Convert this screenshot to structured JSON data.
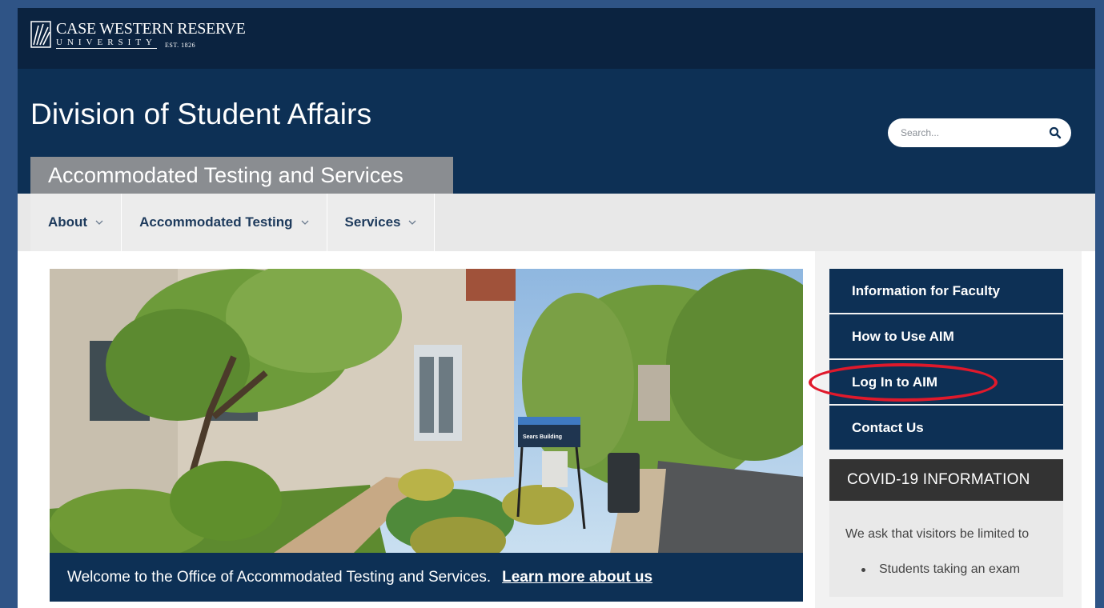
{
  "logo": {
    "name": "CASE WESTERN RESERVE",
    "university": "UNIVERSITY",
    "established": "EST. 1826"
  },
  "header": {
    "division_title": "Division of Student Affairs",
    "department": "Accommodated Testing and Services",
    "search_placeholder": "Search..."
  },
  "nav": {
    "items": [
      {
        "label": "About"
      },
      {
        "label": "Accommodated Testing"
      },
      {
        "label": "Services"
      }
    ]
  },
  "hero": {
    "caption": "Welcome to the Office of Accommodated Testing and Services.",
    "link": "Learn more about us",
    "sign_text": "Sears Building"
  },
  "sidebar": {
    "buttons": [
      {
        "label": "Information for Faculty"
      },
      {
        "label": "How to Use AIM"
      },
      {
        "label": "Log In to AIM"
      },
      {
        "label": "Contact Us"
      }
    ],
    "highlighted_index": 2,
    "highlight_color": "#e0192b"
  },
  "covid": {
    "heading": "COVID-19 INFORMATION",
    "intro": "We ask that visitors be limited to",
    "items": [
      "Students taking an exam"
    ]
  },
  "colors": {
    "navy": "#0d3055",
    "logo_bar": "#0b2340",
    "gray_tab": "#8a8d91",
    "page_border": "#2f5486"
  }
}
